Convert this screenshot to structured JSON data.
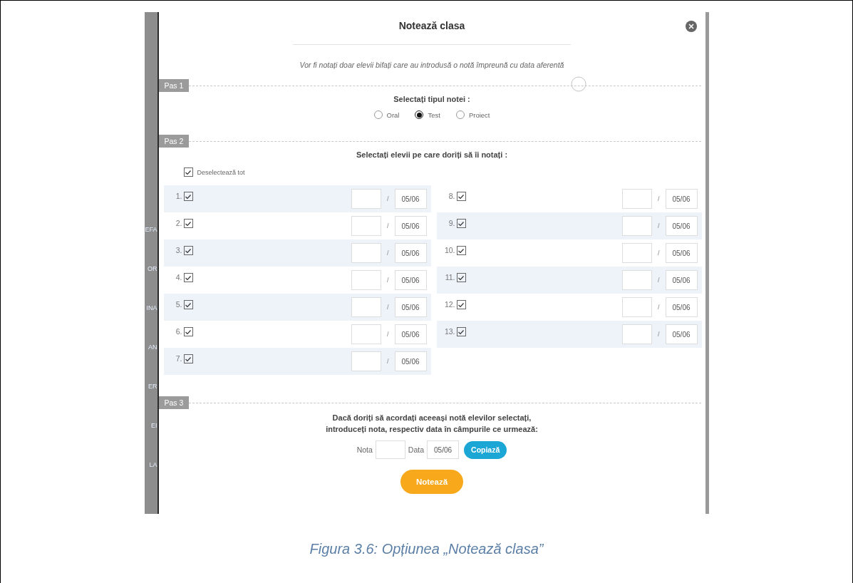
{
  "background_fragments": [
    "EFA",
    "OR",
    "INA",
    "AN",
    "ER",
    "EI",
    "LA"
  ],
  "dialog": {
    "title": "Notează clasa",
    "info": "Vor fi notați doar elevii bifați care au introdusă o notă împreună cu data aferentă"
  },
  "step1": {
    "tag": "Pas 1",
    "heading": "Selectați tipul notei :",
    "options": [
      {
        "label": "Oral",
        "selected": false
      },
      {
        "label": "Test",
        "selected": true
      },
      {
        "label": "Proiect",
        "selected": false
      }
    ]
  },
  "step2": {
    "tag": "Pas 2",
    "heading": "Selectați elevii pe care doriți să îi notați :",
    "toggle_all": {
      "label": "Deselectează tot",
      "checked": true
    },
    "students": [
      {
        "number": "1.",
        "checked": true,
        "date": "05/06"
      },
      {
        "number": "2.",
        "checked": true,
        "date": "05/06"
      },
      {
        "number": "3.",
        "checked": true,
        "date": "05/06"
      },
      {
        "number": "4.",
        "checked": true,
        "date": "05/06"
      },
      {
        "number": "5.",
        "checked": true,
        "date": "05/06"
      },
      {
        "number": "6.",
        "checked": true,
        "date": "05/06"
      },
      {
        "number": "7.",
        "checked": true,
        "date": "05/06"
      },
      {
        "number": "8.",
        "checked": true,
        "date": "05/06"
      },
      {
        "number": "9.",
        "checked": true,
        "date": "05/06"
      },
      {
        "number": "10.",
        "checked": true,
        "date": "05/06"
      },
      {
        "number": "11.",
        "checked": true,
        "date": "05/06"
      },
      {
        "number": "12.",
        "checked": true,
        "date": "05/06"
      },
      {
        "number": "13.",
        "checked": true,
        "date": "05/06"
      }
    ],
    "separator": "/"
  },
  "step3": {
    "tag": "Pas 3",
    "lines": [
      "Dacă doriți să acordați aceeași notă elevilor selectați,",
      "introduceți nota, respectiv data în câmpurile ce urmează:"
    ],
    "grade_label": "Nota",
    "date_label": "Data",
    "date": "05/06",
    "copy_button": "Copiază"
  },
  "submit_button": "Notează",
  "caption": "Figura 3.6: Opțiunea „Notează clasa”"
}
